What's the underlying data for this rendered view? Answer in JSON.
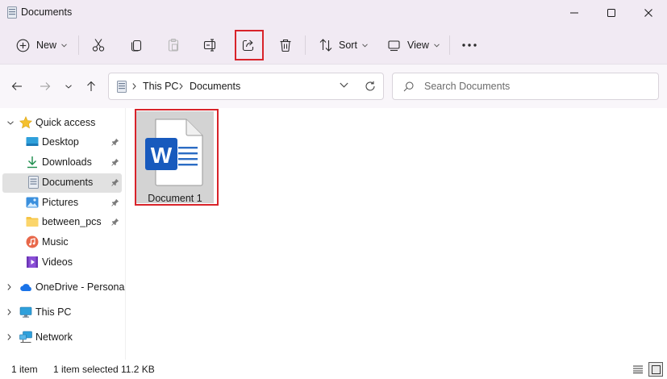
{
  "window": {
    "title": "Documents",
    "title_icon": "documents-folder-icon",
    "controls": [
      "minimize-icon",
      "maximize-icon",
      "close-icon"
    ]
  },
  "commandbar": {
    "new_label": "New",
    "sort_label": "Sort",
    "view_label": "View",
    "buttons": [
      "cut-icon",
      "copy-icon",
      "paste-icon",
      "rename-icon",
      "share-icon",
      "delete-icon"
    ],
    "more_icon": "more-icon"
  },
  "address": {
    "crumbs": [
      "This PC",
      "Documents"
    ]
  },
  "search": {
    "placeholder": "Search Documents"
  },
  "nav": {
    "quick_access": "Quick access",
    "items": [
      {
        "label": "Desktop",
        "icon": "desktop-icon",
        "pinned": true
      },
      {
        "label": "Downloads",
        "icon": "downloads-icon",
        "pinned": true
      },
      {
        "label": "Documents",
        "icon": "documents-icon",
        "pinned": true,
        "selected": true
      },
      {
        "label": "Pictures",
        "icon": "pictures-icon",
        "pinned": true
      },
      {
        "label": "between_pcs",
        "icon": "folder-icon",
        "pinned": true
      },
      {
        "label": "Music",
        "icon": "music-icon",
        "pinned": false
      },
      {
        "label": "Videos",
        "icon": "videos-icon",
        "pinned": false
      }
    ],
    "onedrive": "OneDrive - Personal",
    "this_pc": "This PC",
    "network": "Network"
  },
  "files": [
    {
      "name": "Document 1",
      "type": "word-document-icon",
      "selected": true
    }
  ],
  "status": {
    "count": "1 item",
    "selected": "1 item selected",
    "size": "11.2 KB"
  },
  "colors": {
    "titlebar_bg": "#f1eaf3",
    "highlight_red": "#d8232a",
    "word_blue": "#185abd",
    "selected_tile": "#d3d3d3"
  }
}
